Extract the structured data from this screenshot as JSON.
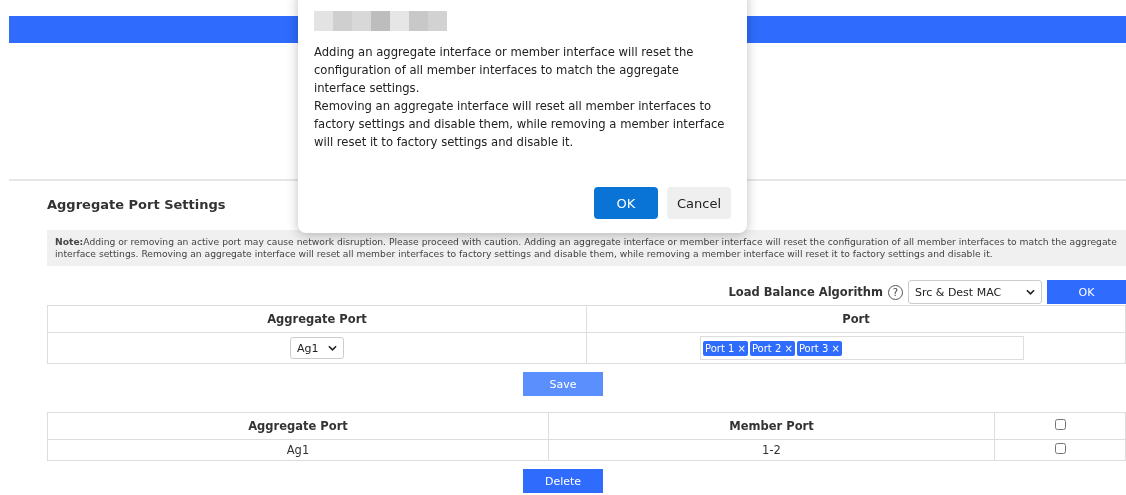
{
  "page": {
    "heading": "Aggregate Port Settings",
    "note": {
      "label": "Note:",
      "text": "Adding or removing an active port may cause network disruption. Please proceed with caution. Adding an aggregate interface or member interface will reset the configuration of all member interfaces to match the aggregate interface settings. Removing an aggregate interface will reset all member interfaces to factory settings and disable them, while removing a member interface will reset it to factory settings and disable it."
    },
    "load_balance": {
      "label": "Load Balance Algorithm",
      "help": "?",
      "value": "Src & Dest MAC",
      "button": "OK"
    },
    "config_table": {
      "columns": [
        "Aggregate Port",
        "Port"
      ],
      "aggregate_value": "Ag1",
      "ports": [
        {
          "label": "Port 1",
          "remove": "×"
        },
        {
          "label": "Port 2",
          "remove": "×"
        },
        {
          "label": "Port 3",
          "remove": "×"
        }
      ]
    },
    "save_button": "Save",
    "list_table": {
      "columns": [
        "Aggregate Port",
        "Member Port"
      ],
      "header_checked": false,
      "rows": [
        {
          "aggregate": "Ag1",
          "members": "1-2",
          "checked": false
        }
      ]
    },
    "delete_button": "Delete"
  },
  "dialog": {
    "paragraphs": [
      "Adding an aggregate interface or member interface will reset the configuration of all member interfaces to match the aggregate interface settings.",
      "Removing an aggregate interface will reset all member interfaces to factory settings and disable them, while removing a member interface will reset it to factory settings and disable it."
    ],
    "buttons": [
      {
        "label": "OK",
        "kind": "primary"
      },
      {
        "label": "Cancel",
        "kind": "secondary"
      }
    ]
  }
}
